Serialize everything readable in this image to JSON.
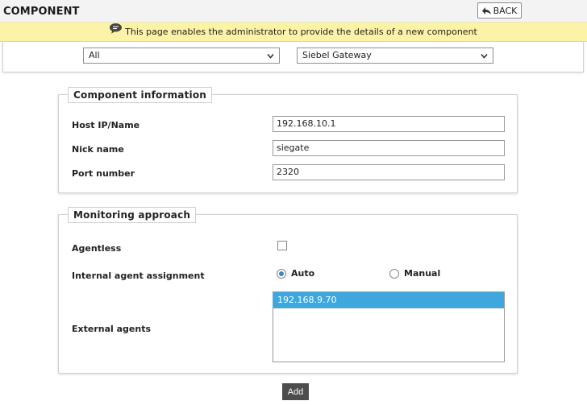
{
  "header": {
    "title": "COMPONENT",
    "back_label": "BACK"
  },
  "info_bar": {
    "message": "This page enables the administrator to provide the details of a new component"
  },
  "filters": {
    "category": "All",
    "component_type": "Siebel Gateway"
  },
  "component_info": {
    "legend": "Component information",
    "host_label": "Host IP/Name",
    "host_value": "192.168.10.1",
    "nick_label": "Nick name",
    "nick_value": "siegate",
    "port_label": "Port number",
    "port_value": "2320"
  },
  "monitoring": {
    "legend": "Monitoring approach",
    "agentless_label": "Agentless",
    "agentless_checked": false,
    "internal_label": "Internal agent assignment",
    "auto_label": "Auto",
    "manual_label": "Manual",
    "selected_assignment": "Auto",
    "external_label": "External agents",
    "external_agents": [
      "192.168.9.70"
    ]
  },
  "actions": {
    "add_label": "Add"
  },
  "colors": {
    "info_bar_bg": "#fdf3a8",
    "selected_item_bg": "#3ea7de",
    "add_button_bg": "#4d4d4d",
    "radio_accent": "#3a86c8"
  },
  "icons": {
    "back": "back-arrow-icon",
    "info": "speech-bubble-icon",
    "dropdown": "chevron-down-icon"
  }
}
